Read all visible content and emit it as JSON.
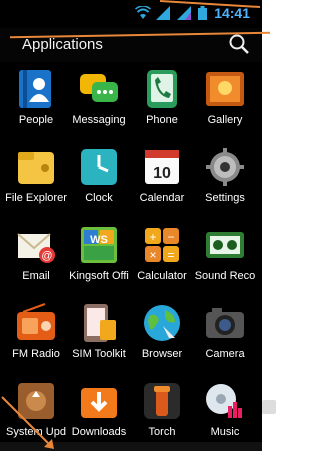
{
  "status": {
    "time": "14:41"
  },
  "header": {
    "title": "Applications"
  },
  "apps": [
    {
      "label": "People"
    },
    {
      "label": "Messaging"
    },
    {
      "label": "Phone"
    },
    {
      "label": "Gallery"
    },
    {
      "label": "File Explorer"
    },
    {
      "label": "Clock"
    },
    {
      "label": "Calendar"
    },
    {
      "label": "Settings"
    },
    {
      "label": "Email"
    },
    {
      "label": "Kingsoft Offi"
    },
    {
      "label": "Calculator"
    },
    {
      "label": "Sound Reco"
    },
    {
      "label": "FM Radio"
    },
    {
      "label": "SIM Toolkit"
    },
    {
      "label": "Browser"
    },
    {
      "label": "Camera"
    },
    {
      "label": "System Upd"
    },
    {
      "label": "Downloads"
    },
    {
      "label": "Torch"
    },
    {
      "label": "Music"
    }
  ],
  "calendar": {
    "day": "10"
  }
}
